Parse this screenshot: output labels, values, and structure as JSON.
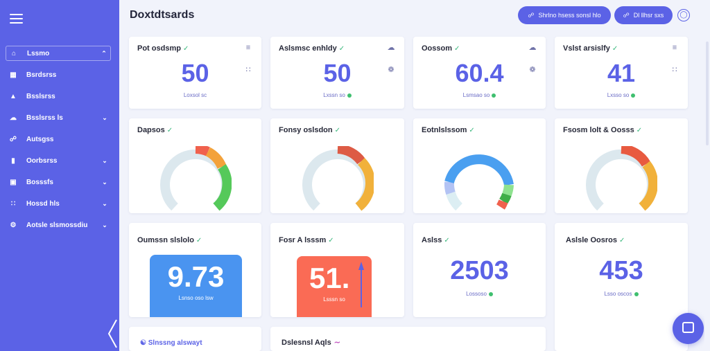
{
  "app": {
    "title": "Doxtdtsards"
  },
  "header": {
    "btn_primary": "Shrlno hsess sonsl hlo",
    "btn_secondary": "Dl llhsr sxs"
  },
  "sidebar": {
    "items": [
      {
        "label": "Lssmo",
        "icon": "home-icon",
        "chevron": "up"
      },
      {
        "label": "Bsrdsrss",
        "icon": "grid-icon",
        "chevron": ""
      },
      {
        "label": "Bsslsrss",
        "icon": "user-icon",
        "chevron": ""
      },
      {
        "label": "Bsslsrss ls",
        "icon": "cloud-icon",
        "chevron": "down"
      },
      {
        "label": "Autsgss",
        "icon": "share-icon",
        "chevron": ""
      },
      {
        "label": "Oorbsrss",
        "icon": "file-icon",
        "chevron": "down"
      },
      {
        "label": "Bosssfs",
        "icon": "box-icon",
        "chevron": "down"
      },
      {
        "label": "Hossd hls",
        "icon": "nodes-icon",
        "chevron": "down"
      },
      {
        "label": "Aotsle slsmossdiu",
        "icon": "gear-icon",
        "chevron": "down"
      }
    ]
  },
  "stats": [
    {
      "title": "Pot osdsmp",
      "value": "50",
      "sub": "Loxsol sc",
      "icon": "list-icon"
    },
    {
      "title": "Aslsmsc enhldy",
      "value": "50",
      "sub": "Lxssn so",
      "icon": "cloud-icon"
    },
    {
      "title": "Oossom",
      "value": "60.4",
      "sub": "Lsmsao so",
      "icon": "cloud-icon"
    },
    {
      "title": "Vslst arsislfy",
      "value": "41",
      "sub": "Lxsso so",
      "icon": "list-icon"
    }
  ],
  "gauges": [
    {
      "title": "Dapsos",
      "value": 50,
      "color": "#55c95a"
    },
    {
      "title": "Fonsy oslsdon",
      "value": 60,
      "color": "#f1b13b"
    },
    {
      "title": "Eotnlslssom",
      "value": 75,
      "color": "#4a9ff0"
    },
    {
      "title": "Fsosm lolt & Oosss",
      "value": 60,
      "color": "#f1b13b"
    }
  ],
  "bottom": [
    {
      "title": "Oumssn slslolo",
      "value": "9.73",
      "sub": "Lsnso oso lsw",
      "color": "#4a94f0"
    },
    {
      "title": "Fosr A lsssm",
      "value": "51.",
      "sub": "Lsssn so",
      "color": "#fa6b55"
    },
    {
      "title": "Aslss",
      "value": "2503",
      "sub": "Lossoso"
    },
    {
      "title": "Aslsle Oosros",
      "value": "453",
      "sub": "Lsso oscos"
    }
  ],
  "bottom_row": {
    "card1_title": "Slnssng alswayt",
    "card2_title": "Dslesnsl Aqls"
  }
}
